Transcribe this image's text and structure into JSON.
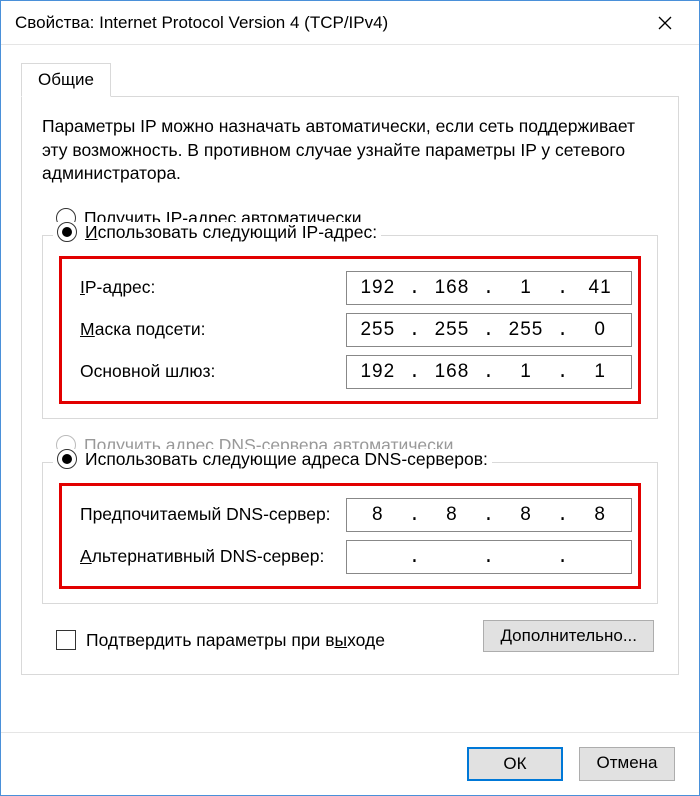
{
  "window": {
    "title": "Свойства: Internet Protocol Version 4 (TCP/IPv4)"
  },
  "tab": {
    "general": "Общие"
  },
  "intro": "Параметры IP можно назначать автоматически, если сеть поддерживает эту возможность. В противном случае узнайте параметры IP у сетевого администратора.",
  "ip_group": {
    "auto": "олучить IP-адрес автоматически",
    "manual": "спользовать следующий IP-адрес:",
    "ip_label": "IP-адрес:",
    "mask_label": "аска подсети:",
    "gw_label": "Основной шлюз:",
    "ip": {
      "a": "192",
      "b": "168",
      "c": "1",
      "d": "41"
    },
    "mask": {
      "a": "255",
      "b": "255",
      "c": "255",
      "d": "0"
    },
    "gw": {
      "a": "192",
      "b": "168",
      "c": "1",
      "d": "1"
    }
  },
  "dns_group": {
    "auto": "Получить адрес DNS-сервера автоматически",
    "manual": "Использовать следующие адреса DNS-серверов:",
    "pref_label": "Предпочитаемый DNS-сервер:",
    "alt_label": "льтернативный DNS-сервер:",
    "pref": {
      "a": "8",
      "b": "8",
      "c": "8",
      "d": "8"
    },
    "alt": {
      "a": "",
      "b": "",
      "c": "",
      "d": ""
    }
  },
  "validate": "Подтвердить параметры при выходе",
  "buttons": {
    "advanced": "ополнительно...",
    "ok": "ОК",
    "cancel": "Отмена"
  }
}
